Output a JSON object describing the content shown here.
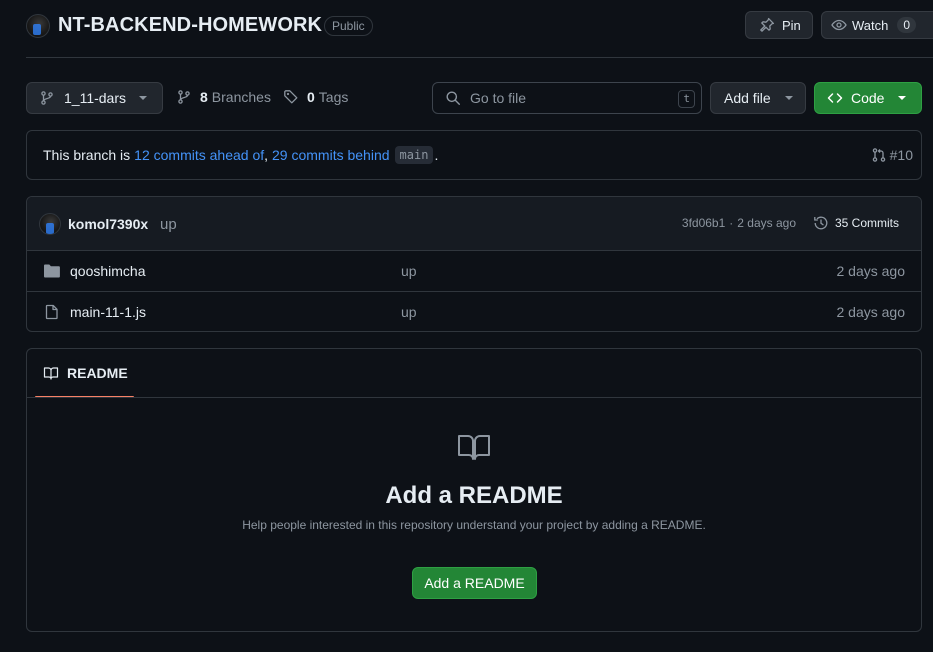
{
  "repo": {
    "name": "NT-BACKEND-HOMEWORK",
    "visibility": "Public",
    "pin_label": "Pin",
    "watch_label": "Watch",
    "watch_count": "0"
  },
  "toolbar": {
    "branch": "1_11-dars",
    "branches_count": "8",
    "branches_label": "Branches",
    "tags_count": "0",
    "tags_label": "Tags",
    "search_placeholder": "Go to file",
    "search_shortcut": "t",
    "add_file_label": "Add file",
    "code_label": "Code"
  },
  "branch_status": {
    "prefix": "This branch is",
    "ahead": "12 commits ahead of",
    "comma": ",",
    "behind": "29 commits behind",
    "base": "main",
    "suffix": ".",
    "pr": "#10"
  },
  "latest_commit": {
    "author": "komol7390x",
    "message": "up",
    "hash": "3fd06b1",
    "sep": "·",
    "time": "2 days ago",
    "commits_label": "35 Commits"
  },
  "files": [
    {
      "name": "qooshimcha",
      "type": "folder",
      "message": "up",
      "time": "2 days ago"
    },
    {
      "name": "main-11-1.js",
      "type": "file",
      "message": "up",
      "time": "2 days ago"
    }
  ],
  "readme": {
    "tab_label": "README",
    "heading": "Add a README",
    "description": "Help people interested in this repository understand your project by adding a README.",
    "button_label": "Add a README"
  },
  "colors": {
    "background": "#0d1117",
    "border": "#30363d",
    "link": "#4493f8",
    "green": "#238636",
    "tab_underline": "#f78166"
  },
  "icons": [
    "repo-avatar",
    "pin-icon",
    "eye-icon",
    "branch-icon",
    "tag-icon",
    "search-icon",
    "caret-down-icon",
    "code-icon",
    "pull-request-icon",
    "history-icon",
    "folder-icon",
    "file-icon",
    "book-icon"
  ]
}
